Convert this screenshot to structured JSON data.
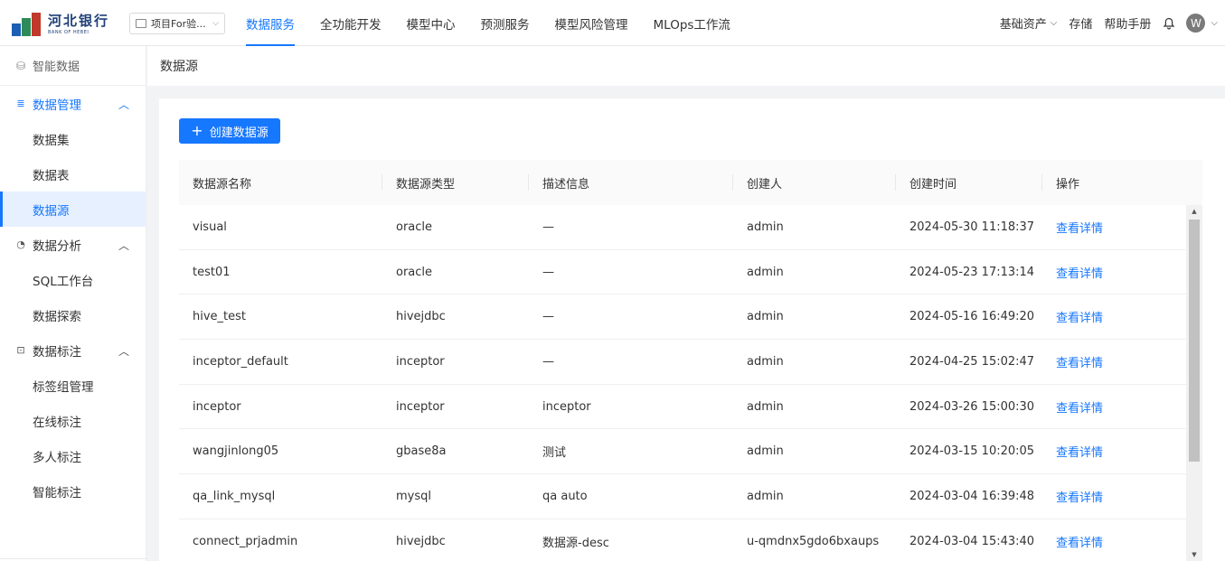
{
  "brand": {
    "name_cn": "河北银行",
    "name_en": "BANK OF HEBEI"
  },
  "project": {
    "label": "项目For验..."
  },
  "nav": {
    "items": [
      {
        "label": "数据服务",
        "active": true
      },
      {
        "label": "全功能开发",
        "active": false
      },
      {
        "label": "模型中心",
        "active": false
      },
      {
        "label": "预测服务",
        "active": false
      },
      {
        "label": "模型风险管理",
        "active": false
      },
      {
        "label": "MLOps工作流",
        "active": false
      }
    ]
  },
  "tools": {
    "assets": "基础资产",
    "storage": "存储",
    "help": "帮助手册",
    "avatar": "W"
  },
  "sidebar": {
    "top": "智能数据",
    "groups": [
      {
        "label": "数据管理",
        "items": [
          "数据集",
          "数据表",
          "数据源"
        ]
      },
      {
        "label": "数据分析",
        "items": [
          "SQL工作台",
          "数据探索"
        ]
      },
      {
        "label": "数据标注",
        "items": [
          "标签组管理",
          "在线标注",
          "多人标注",
          "智能标注"
        ]
      }
    ]
  },
  "breadcrumb": "数据源",
  "create_button": "创建数据源",
  "table": {
    "headers": [
      "数据源名称",
      "数据源类型",
      "描述信息",
      "创建人",
      "创建时间",
      "操作"
    ],
    "action_label": "查看详情",
    "rows": [
      [
        "visual",
        "oracle",
        "—",
        "admin",
        "2024-05-30 11:18:37"
      ],
      [
        "test01",
        "oracle",
        "—",
        "admin",
        "2024-05-23 17:13:14"
      ],
      [
        "hive_test",
        "hivejdbc",
        "—",
        "admin",
        "2024-05-16 16:49:20"
      ],
      [
        "inceptor_default",
        "inceptor",
        "—",
        "admin",
        "2024-04-25 15:02:47"
      ],
      [
        "inceptor",
        "inceptor",
        "inceptor",
        "admin",
        "2024-03-26 15:00:30"
      ],
      [
        "wangjinlong05",
        "gbase8a",
        "测试",
        "admin",
        "2024-03-15 10:20:05"
      ],
      [
        "qa_link_mysql",
        "mysql",
        "qa auto",
        "admin",
        "2024-03-04 16:39:48"
      ],
      [
        "connect_prjadmin",
        "hivejdbc",
        "数据源-desc",
        "u-qmdnx5gdo6bxaups",
        "2024-03-04 15:43:40"
      ]
    ]
  },
  "colors": {
    "accent": "#1677ff",
    "active_bg": "#e6f0ff"
  }
}
